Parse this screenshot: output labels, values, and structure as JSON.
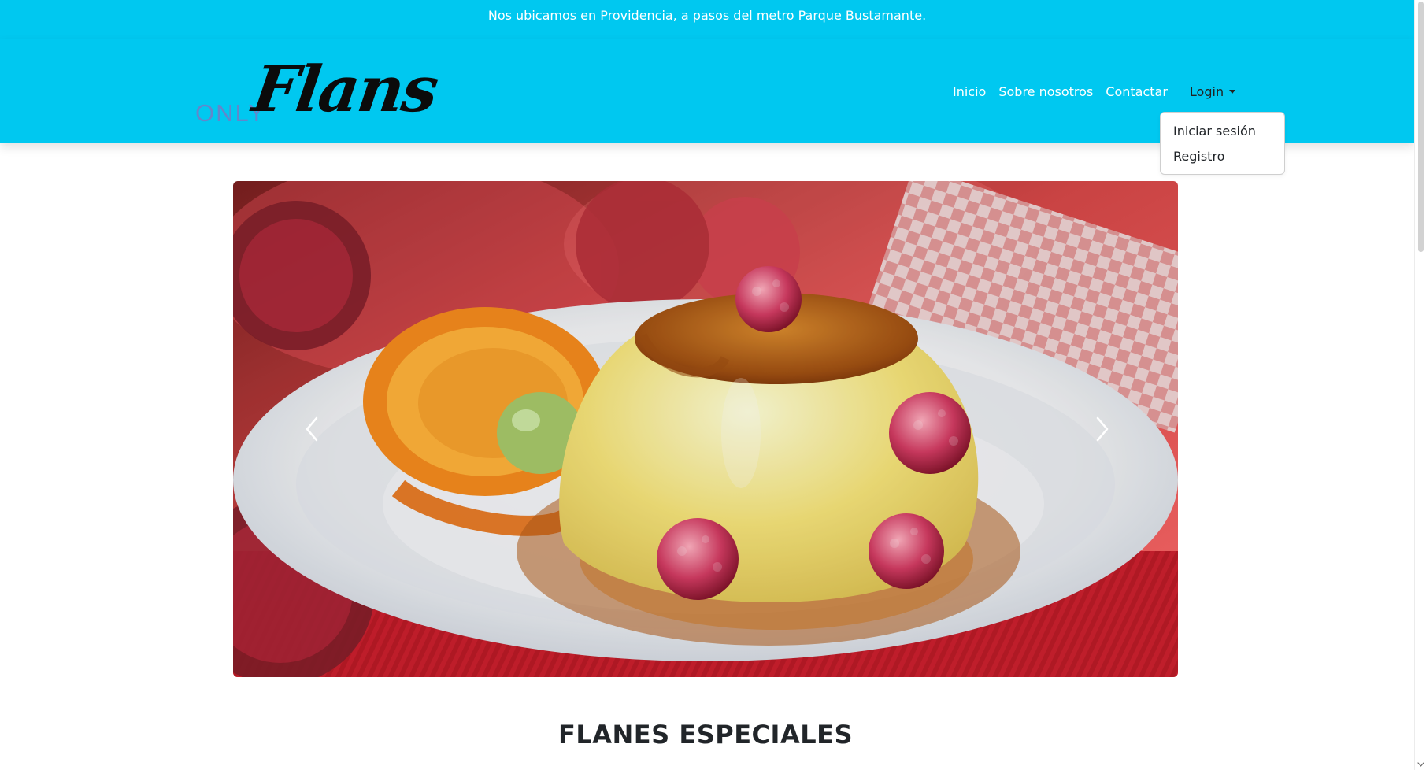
{
  "announcement": "Nos ubicamos en Providencia, a pasos del metro Parque Bustamante.",
  "brand": {
    "prefix": "ONLY",
    "name": "Flans"
  },
  "nav": {
    "items": [
      "Inicio",
      "Sobre nosotros",
      "Contactar"
    ],
    "login_label": "Login",
    "dropdown": [
      "Iniciar sesión",
      "Registro"
    ]
  },
  "carousel": {
    "image": "flan-with-orange-and-raspberries"
  },
  "section": {
    "title": "FLANES ESPECIALES"
  },
  "colors": {
    "primary": "#00c8f0",
    "text_dark": "#212529",
    "white": "#ffffff"
  }
}
